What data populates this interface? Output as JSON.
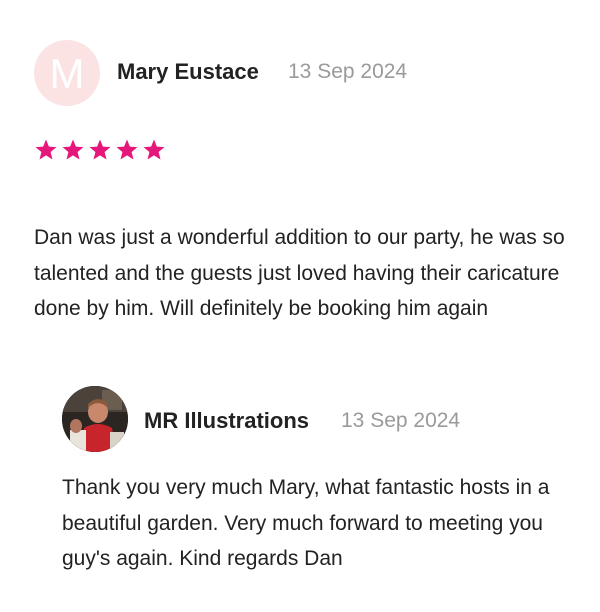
{
  "review": {
    "avatar_initial": "M",
    "reviewer_name": "Mary Eustace",
    "date": "13 Sep 2024",
    "rating": 5,
    "rating_max": 5,
    "star_color": "#e6177a",
    "avatar_bg_color": "#fbe3e4",
    "text": "Dan was just a wonderful addition to our party, he was so talented and the guests just loved having their caricature done by him. Will definitely be booking him again"
  },
  "reply": {
    "author_name": "MR Illustrations",
    "date": "13 Sep 2024",
    "text": "Thank you very much Mary, what fantastic hosts in a beautiful garden. Very much forward to meeting you guy's again. Kind regards Dan"
  }
}
